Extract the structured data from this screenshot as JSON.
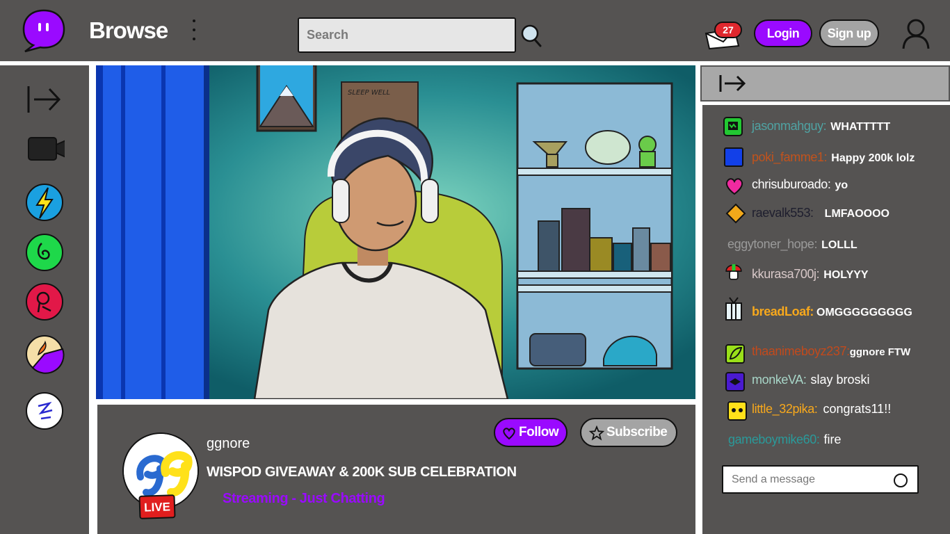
{
  "header": {
    "title": "Browse",
    "search_placeholder": "Search",
    "notification_count": "27",
    "login_label": "Login",
    "signup_label": "Sign up",
    "icons": [
      "logo-icon",
      "more-icon",
      "search-icon",
      "inbox-icon",
      "profile-icon"
    ]
  },
  "sidebar": {
    "icons": [
      "expand-icon",
      "camera-icon",
      "channel-lightning-icon",
      "channel-swirl-icon",
      "channel-face-icon",
      "channel-pacman-icon",
      "channel-kanji-icon"
    ]
  },
  "stream": {
    "streamer": "ggnore",
    "title": "WISPOD GIVEAWAY & 200K SUB CELEBRATION",
    "category": "Streaming - Just Chatting",
    "live_label": "LIVE",
    "follow_label": "Follow",
    "subscribe_label": "Subscribe",
    "poster_text": "SLEEP WELL"
  },
  "chat": {
    "send_placeholder": "Send a message",
    "messages": [
      {
        "user": "jasonmahguy:",
        "text": "WHATTTTT",
        "color": "#4fa3a3"
      },
      {
        "user": "poki_famme1:",
        "text": "Happy 200k lolz",
        "color": "#c2531c"
      },
      {
        "user": "chrisuburoado:",
        "text": "yo",
        "color": "#ffffff"
      },
      {
        "user": "raevalk553:",
        "text": "LMFAOOOO",
        "color": "#1e1e2e"
      },
      {
        "user": "eggytoner_hope:",
        "text": "LOLLL",
        "color": "#9a9a9a"
      },
      {
        "user": "kkurasa700j:",
        "text": "HOLYYY",
        "color": "#d8c8c8"
      },
      {
        "user": "breadLoaf:",
        "text": "OMGGGGGGGGG",
        "color": "#f7a81c"
      },
      {
        "user": "thaanimeboyz237:",
        "text": "ggnore FTW",
        "color": "#c24a1c"
      },
      {
        "user": "monkeVA:",
        "text": "slay broski",
        "color": "#a8d6c8"
      },
      {
        "user": "little_32pika:",
        "text": "congrats11!!",
        "color": "#f7a81c"
      },
      {
        "user": "gameboymike60:",
        "text": "fire",
        "color": "#2a9a9a"
      }
    ]
  }
}
